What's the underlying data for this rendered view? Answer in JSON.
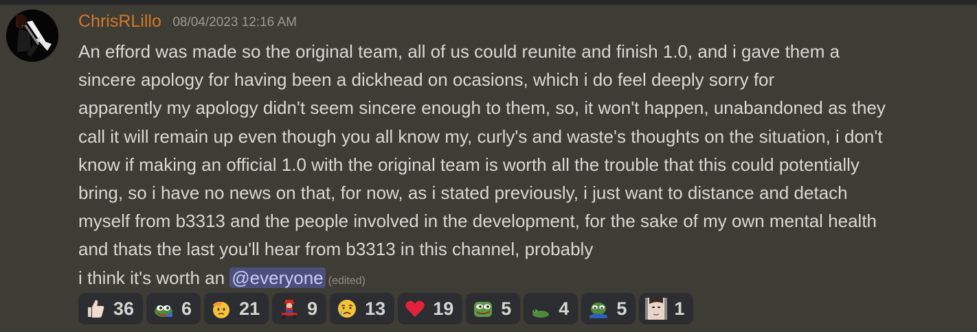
{
  "message": {
    "author": "ChrisRLillo",
    "author_color": "#d4772a",
    "timestamp": "08/04/2023 12:16 AM",
    "lines": [
      "An efford was made so the original team, all of us could reunite and finish 1.0, and i gave them a",
      "sincere apology for having been a dickhead on ocasions, which i do feel deeply sorry for",
      "apparently my apology didn't seem sincere enough to them, so, it won't happen, unabandoned as they",
      "call it will remain up even though you all know my, curly's and waste's thoughts on the situation, i don't",
      "know if making an official 1.0 with the original team is worth all the trouble that this could potentially",
      "bring, so i have no news on that, for now, as i stated previously, i just want to distance and detach",
      "myself from b3313 and the people involved in the development, for the sake of my own mental health",
      "and thats the last you'll hear from b3313 in this channel, probably"
    ],
    "last_line_prefix": "i think it's worth an ",
    "mention": "@everyone",
    "edited_label": "(edited)"
  },
  "reactions": [
    {
      "icon": "thumbs-up-icon",
      "count": "36"
    },
    {
      "icon": "pepe-frog-icon",
      "count": "6"
    },
    {
      "icon": "saluting-face-icon",
      "count": "21"
    },
    {
      "icon": "mario-kart-icon",
      "count": "9"
    },
    {
      "icon": "crying-face-icon",
      "count": "13"
    },
    {
      "icon": "red-heart-icon",
      "count": "19"
    },
    {
      "icon": "pepe-smile-icon",
      "count": "5"
    },
    {
      "icon": "frog-lying-icon",
      "count": "4"
    },
    {
      "icon": "pepe-sad-icon",
      "count": "5"
    },
    {
      "icon": "man-face-icon",
      "count": "1"
    }
  ],
  "colors": {
    "background": "#3d3c35",
    "reaction_bg": "#2b2d31",
    "mention_bg": "#4c4f7b",
    "mention_text": "#c9cdfb"
  }
}
